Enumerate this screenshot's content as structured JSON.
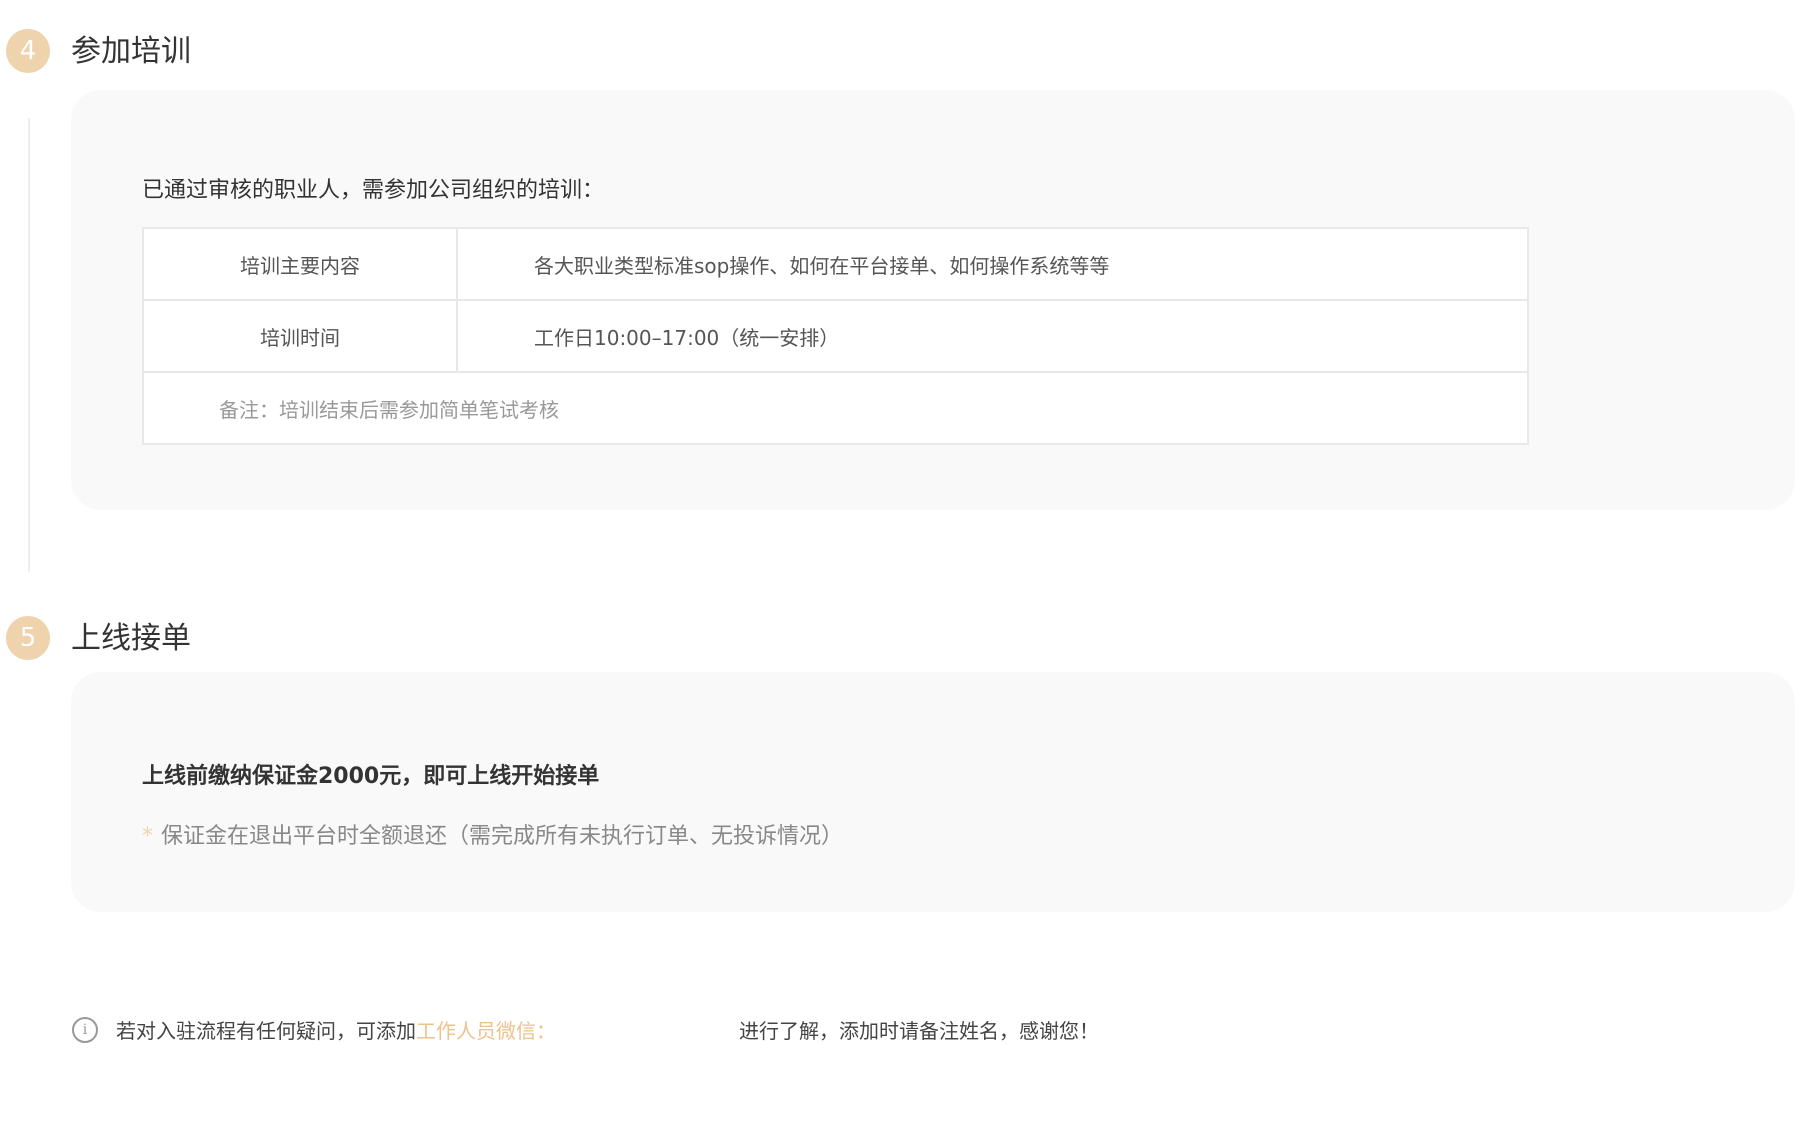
{
  "colors": {
    "accent": "#eed3ad",
    "link": "#eec28d",
    "card_bg": "#f9f9f9"
  },
  "step4": {
    "number": "4",
    "title": "参加培训",
    "intro": "已通过审核的职业人，需参加公司组织的培训：",
    "table": {
      "rows": [
        {
          "label": "培训主要内容",
          "value": "各大职业类型标准sop操作、如何在平台接单、如何操作系统等等"
        },
        {
          "label": "培训时间",
          "value": "工作日10:00–17:00（统一安排）"
        }
      ],
      "note": "备注：培训结束后需参加简单笔试考核"
    }
  },
  "step5": {
    "number": "5",
    "title": "上线接单",
    "bold_text": "上线前缴纳保证金2000元，即可上线开始接单",
    "star": "*",
    "note": "保证金在退出平台时全额退还（需完成所有未执行订单、无投诉情况）"
  },
  "footer": {
    "icon": "info-icon",
    "icon_glyph": "i",
    "prefix": "若对入驻流程有任何疑问，可添加",
    "link": "工作人员微信：",
    "suffix": "进行了解，添加时请备注姓名，感谢您！"
  }
}
